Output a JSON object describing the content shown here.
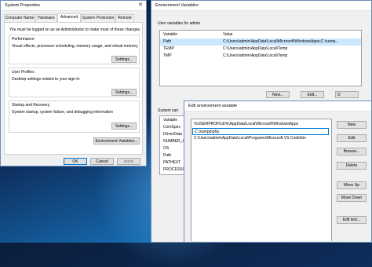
{
  "system_properties": {
    "title": "System Properties",
    "tabs": [
      "Computer Name",
      "Hardware",
      "Advanced",
      "System Protection",
      "Remote"
    ],
    "active_tab": "Advanced",
    "admin_note": "You must be logged on as an Administrator to make most of these changes.",
    "performance": {
      "title": "Performance",
      "text": "Visual effects, processor scheduling, memory usage, and virtual memory",
      "button": "Settings..."
    },
    "user_profiles": {
      "title": "User Profiles",
      "text": "Desktop settings related to your sign-in",
      "button": "Settings..."
    },
    "startup_recovery": {
      "title": "Startup and Recovery",
      "text": "System startup, system failure, and debugging information",
      "button": "Settings..."
    },
    "env_button": "Environment Variables...",
    "ok": "OK",
    "cancel": "Cancel",
    "apply": "Apply"
  },
  "environment_variables": {
    "title": "Environment Variables",
    "user_section": "User variables for admin",
    "col_variable": "Variable",
    "col_value": "Value",
    "user_vars": [
      {
        "name": "Path",
        "value": "C:\\Users\\admin\\AppData\\Local\\Microsoft\\WindowsApps;C:\\xamp..."
      },
      {
        "name": "TEMP",
        "value": "C:\\Users\\admin\\AppData\\Local\\Temp"
      },
      {
        "name": "TMP",
        "value": "C:\\Users\\admin\\AppData\\Local\\Temp"
      }
    ],
    "new": "New...",
    "edit": "Edit...",
    "delete": "D",
    "system_section": "System vari",
    "system_vars": [
      "Variable",
      "ComSpec",
      "DriverData",
      "NUMBER_O",
      "OS",
      "Path",
      "PATHEXT",
      "PROCESSO"
    ]
  },
  "edit_env": {
    "title": "Edit environment variable",
    "entries": [
      "%USERPROFILE%\\AppData\\Local\\Microsoft\\WindowsApps",
      "C:\\xampp\\php",
      "C:\\Users\\admin\\AppData\\Local\\Programs\\Microsoft VS Code\\bin"
    ],
    "buttons": {
      "new": "New",
      "edit": "Edit",
      "browse": "Browse...",
      "delete": "Delete",
      "move_up": "Move Up",
      "move_down": "Move Down",
      "edit_text": "Edit text..."
    }
  },
  "close_glyph": "✕"
}
